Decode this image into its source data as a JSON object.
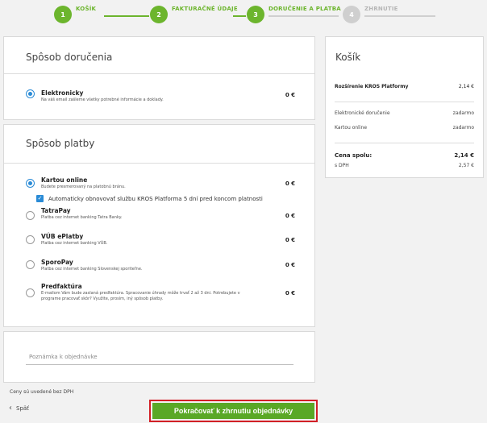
{
  "steps": [
    {
      "num": "1",
      "label": "KOŠÍK",
      "state": "active"
    },
    {
      "num": "2",
      "label": "FAKTURAČNÉ ÚDAJE",
      "state": "active"
    },
    {
      "num": "3",
      "label": "DORUČENIE A PLATBA",
      "state": "active"
    },
    {
      "num": "4",
      "label": "ZHRNUTIE",
      "state": "inactive"
    }
  ],
  "delivery": {
    "title": "Spôsob doručenia",
    "options": [
      {
        "title": "Elektronicky",
        "desc": "Na váš email zašleme všetky potrebné informácie a doklady.",
        "price": "0 €",
        "selected": true
      }
    ]
  },
  "payment": {
    "title": "Spôsob platby",
    "card": {
      "title": "Kartou online",
      "desc": "Budete presmerovaný na platobnú bránu.",
      "price": "0 €"
    },
    "auto_renew_label": "Automaticky obnovovať službu KROS Platforma 5 dní pred koncom platnosti",
    "tatrapay": {
      "title": "TatraPay",
      "desc": "Platba cez internet banking Tatra Banky.",
      "price": "0 €"
    },
    "vub": {
      "title": "VÚB ePlatby",
      "desc": "Platba cez internet banking VÚB.",
      "price": "0 €"
    },
    "sporopay": {
      "title": "SporoPay",
      "desc": "Platba cez internet banking Slovenskej sporiteľne.",
      "price": "0 €"
    },
    "proforma": {
      "title": "Predfaktúra",
      "desc": "E-mailom Vám bude zaslaná predfaktúra. Spracovanie úhrady môže trvať 2 až 3 dni. Potrebujete v programe pracovať skôr? Využite, prosím, iný spôsob platby.",
      "price": "0 €"
    }
  },
  "note": {
    "placeholder": "Poznámka k objednávke"
  },
  "footnote": "Ceny sú uvedené bez DPH",
  "back_label": "Späť",
  "continue_label": "Pokračovať k zhrnutiu objednávky",
  "cart": {
    "title": "Košík",
    "item": {
      "name": "Rozšírenie KROS Platformy",
      "price": "2,14 €"
    },
    "delivery": {
      "name": "Elektronické doručenie",
      "price": "zadarmo"
    },
    "payment": {
      "name": "Kartou online",
      "price": "zadarmo"
    },
    "total": {
      "name": "Cena spolu:",
      "price": "2,14 €"
    },
    "vat": {
      "name": "s DPH",
      "price": "2,57 €"
    }
  },
  "colors": {
    "accent": "#6cb52d",
    "radio": "#2a8bd6",
    "highlight": "#d21f26"
  }
}
